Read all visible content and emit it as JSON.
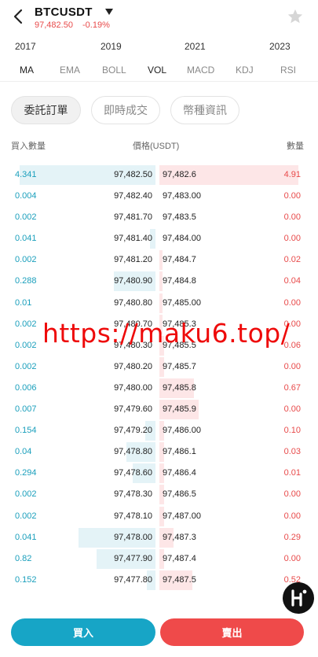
{
  "header": {
    "symbol": "BTCUSDT",
    "price": "97,482.50",
    "change": "-0.19%"
  },
  "timeline": [
    "2017",
    "2019",
    "2021",
    "2023"
  ],
  "indicators": [
    {
      "label": "MA",
      "active": true
    },
    {
      "label": "EMA",
      "active": false
    },
    {
      "label": "BOLL",
      "active": false
    },
    {
      "label": "VOL",
      "active": true
    },
    {
      "label": "MACD",
      "active": false
    },
    {
      "label": "KDJ",
      "active": false
    },
    {
      "label": "RSI",
      "active": false
    }
  ],
  "tabs": [
    {
      "label": "委託訂單",
      "active": true
    },
    {
      "label": "即時成交",
      "active": false
    },
    {
      "label": "幣種資訊",
      "active": false
    }
  ],
  "columns": {
    "bid_qty": "買入數量",
    "price": "價格(USDT)",
    "ask_qty": "數量"
  },
  "orderbook": {
    "bids": [
      {
        "qty": "4.341",
        "price": "97,482.50",
        "depth": 0.94
      },
      {
        "qty": "0.004",
        "price": "97,482.40",
        "depth": 0
      },
      {
        "qty": "0.002",
        "price": "97,481.70",
        "depth": 0
      },
      {
        "qty": "0.041",
        "price": "97,481.40",
        "depth": 0.04
      },
      {
        "qty": "0.002",
        "price": "97,481.20",
        "depth": 0
      },
      {
        "qty": "0.288",
        "price": "97,480.90",
        "depth": 0.29
      },
      {
        "qty": "0.01",
        "price": "97,480.80",
        "depth": 0
      },
      {
        "qty": "0.002",
        "price": "97,480.70",
        "depth": 0
      },
      {
        "qty": "0.002",
        "price": "97,480.30",
        "depth": 0
      },
      {
        "qty": "0.002",
        "price": "97,480.20",
        "depth": 0
      },
      {
        "qty": "0.006",
        "price": "97,480.00",
        "depth": 0
      },
      {
        "qty": "0.007",
        "price": "97,479.60",
        "depth": 0
      },
      {
        "qty": "0.154",
        "price": "97,479.20",
        "depth": 0.07
      },
      {
        "qty": "0.04",
        "price": "97,478.80",
        "depth": 0.2
      },
      {
        "qty": "0.294",
        "price": "97,478.60",
        "depth": 0.16
      },
      {
        "qty": "0.002",
        "price": "97,478.30",
        "depth": 0
      },
      {
        "qty": "0.002",
        "price": "97,478.10",
        "depth": 0
      },
      {
        "qty": "0.041",
        "price": "97,478.00",
        "depth": 0.53
      },
      {
        "qty": "0.82",
        "price": "97,477.90",
        "depth": 0.41
      },
      {
        "qty": "0.152",
        "price": "97,477.80",
        "depth": 0.06
      }
    ],
    "asks": [
      {
        "price": "97,482.6",
        "qty": "4.91",
        "depth": 0.96
      },
      {
        "price": "97,483.00",
        "qty": "0.00",
        "depth": 0
      },
      {
        "price": "97,483.5",
        "qty": "0.00",
        "depth": 0
      },
      {
        "price": "97,484.00",
        "qty": "0.00",
        "depth": 0
      },
      {
        "price": "97,484.7",
        "qty": "0.02",
        "depth": 0.02
      },
      {
        "price": "97,484.8",
        "qty": "0.04",
        "depth": 0.02
      },
      {
        "price": "97,485.00",
        "qty": "0.00",
        "depth": 0.02
      },
      {
        "price": "97,485.3",
        "qty": "0.00",
        "depth": 0.02
      },
      {
        "price": "97,485.5",
        "qty": "0.06",
        "depth": 0.03
      },
      {
        "price": "97,485.7",
        "qty": "0.00",
        "depth": 0.03
      },
      {
        "price": "97,485.8",
        "qty": "0.67",
        "depth": 0.24
      },
      {
        "price": "97,485.9",
        "qty": "0.00",
        "depth": 0.27
      },
      {
        "price": "97,486.00",
        "qty": "0.10",
        "depth": 0.03
      },
      {
        "price": "97,486.1",
        "qty": "0.03",
        "depth": 0.03
      },
      {
        "price": "97,486.4",
        "qty": "0.01",
        "depth": 0.03
      },
      {
        "price": "97,486.5",
        "qty": "0.00",
        "depth": 0.03
      },
      {
        "price": "97,487.00",
        "qty": "0.00",
        "depth": 0.03
      },
      {
        "price": "97,487.3",
        "qty": "0.29",
        "depth": 0.1
      },
      {
        "price": "97,487.4",
        "qty": "0.00",
        "depth": 0.03
      },
      {
        "price": "97,487.5",
        "qty": "0.52",
        "depth": 0.23
      }
    ]
  },
  "watermark": "https://maku6.top/",
  "actions": {
    "buy": "買入",
    "sell": "賣出"
  },
  "colors": {
    "bid": "#1a9fbc",
    "ask": "#e84a4a",
    "buy_button": "#17a5c6",
    "sell_button": "#ef4a4a"
  },
  "icons": {
    "back": "chevron-left-icon",
    "dropdown": "caret-down-icon",
    "favorite": "star-icon",
    "assistant": "h-logo-icon"
  }
}
